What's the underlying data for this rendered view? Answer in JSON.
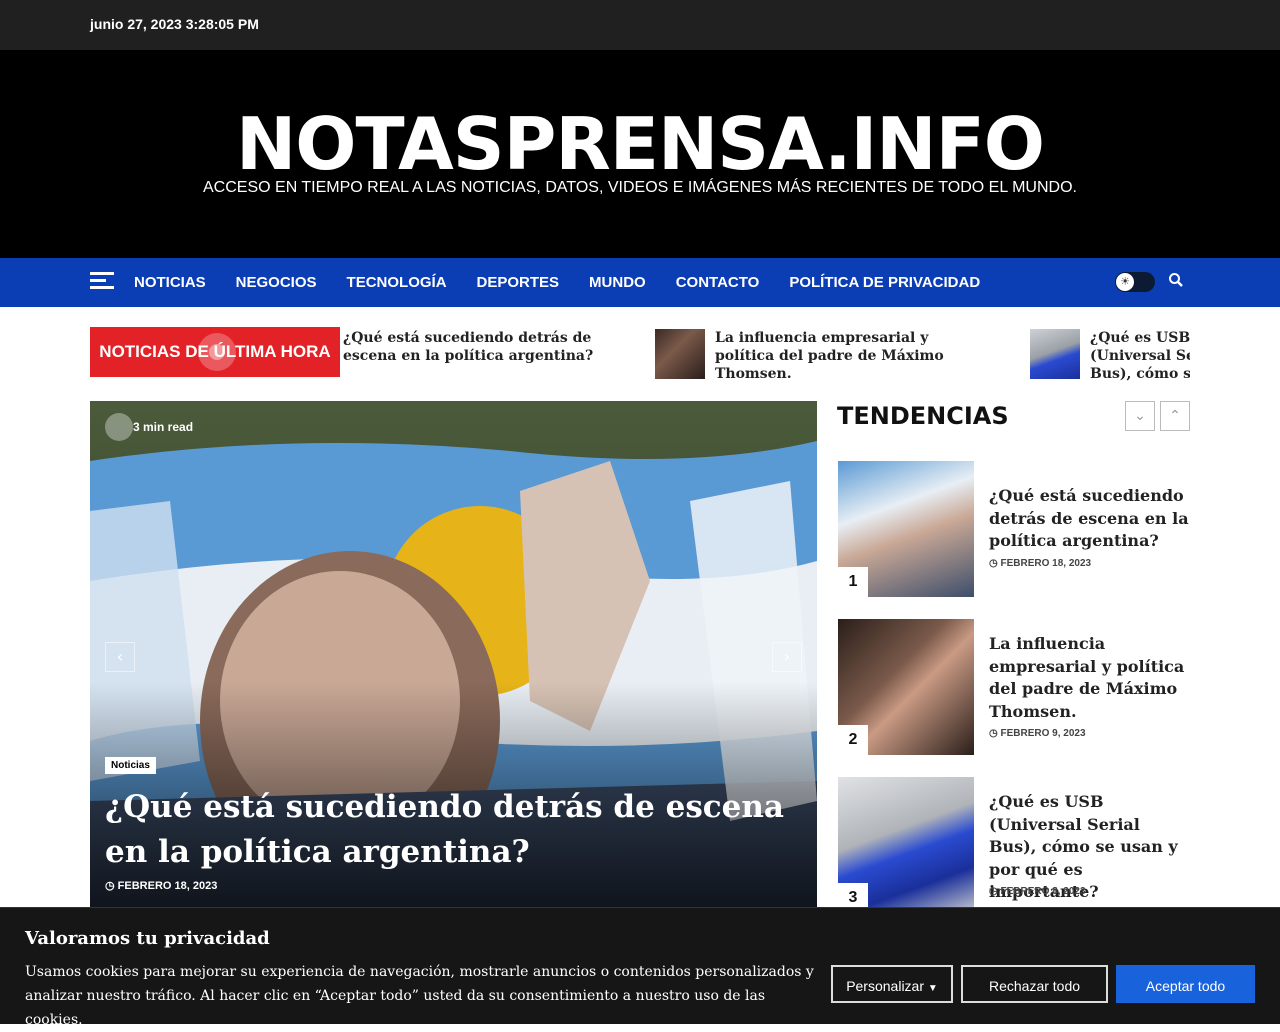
{
  "topbar": {
    "datetime": "junio 27, 2023 3:28:05 PM"
  },
  "site": {
    "title": "NOTASPRENSA.INFO",
    "tagline": "ACCESO EN TIEMPO REAL A LAS NOTICIAS, DATOS, VIDEOS E IMÁGENES MÁS RECIENTES DE TODO EL MUNDO."
  },
  "nav": {
    "items": [
      "NOTICIAS",
      "NEGOCIOS",
      "TECNOLOGÍA",
      "DEPORTES",
      "MUNDO",
      "CONTACTO",
      "POLÍTICA DE PRIVACIDAD"
    ]
  },
  "breaking": {
    "label": "NOTICIAS DE ÚLTIMA HORA",
    "items": [
      {
        "title": "¿Qué está sucediendo detrás de escena en la política argentina?"
      },
      {
        "title": "La influencia empresarial y política del padre de Máximo Thomsen."
      },
      {
        "title": "¿Qué es USB (Universal Serial Bus), cómo se usan y por qué es importante?"
      }
    ]
  },
  "hero": {
    "read_time": "3 min read",
    "category": "Noticias",
    "title": "¿Qué está sucediendo detrás de escena en la política argentina?",
    "date": "FEBRERO 18, 2023",
    "prev": "‹",
    "next": "›"
  },
  "trending": {
    "heading": "TENDENCIAS",
    "items": [
      {
        "num": "1",
        "title": "¿Qué está sucediendo detrás de escena en la política argentina?",
        "date": "FEBRERO 18, 2023"
      },
      {
        "num": "2",
        "title": "La influencia empresarial y política del padre de Máximo Thomsen.",
        "date": "FEBRERO 9, 2023"
      },
      {
        "num": "3",
        "title": "¿Qué es USB (Universal Serial Bus), cómo se usan y por qué es importante?",
        "date": "FEBRERO 8, 2023"
      }
    ]
  },
  "cookie": {
    "title": "Valoramos tu privacidad",
    "text": "Usamos cookies para mejorar su experiencia de navegación, mostrarle anuncios o contenidos personalizados y analizar nuestro tráfico. Al hacer clic en “Aceptar todo” usted da su consentimiento a nuestro uso de las cookies.",
    "customize": "Personalizar",
    "reject": "Rechazar todo",
    "accept": "Aceptar todo"
  },
  "colors": {
    "nav_bg": "#0b3db5",
    "breaking_bg": "#e32227",
    "accept_bg": "#1863dc"
  },
  "icons": {
    "menu": "hamburger-icon",
    "search": "search-icon",
    "theme": "sun-icon",
    "clock": "clock-icon"
  }
}
